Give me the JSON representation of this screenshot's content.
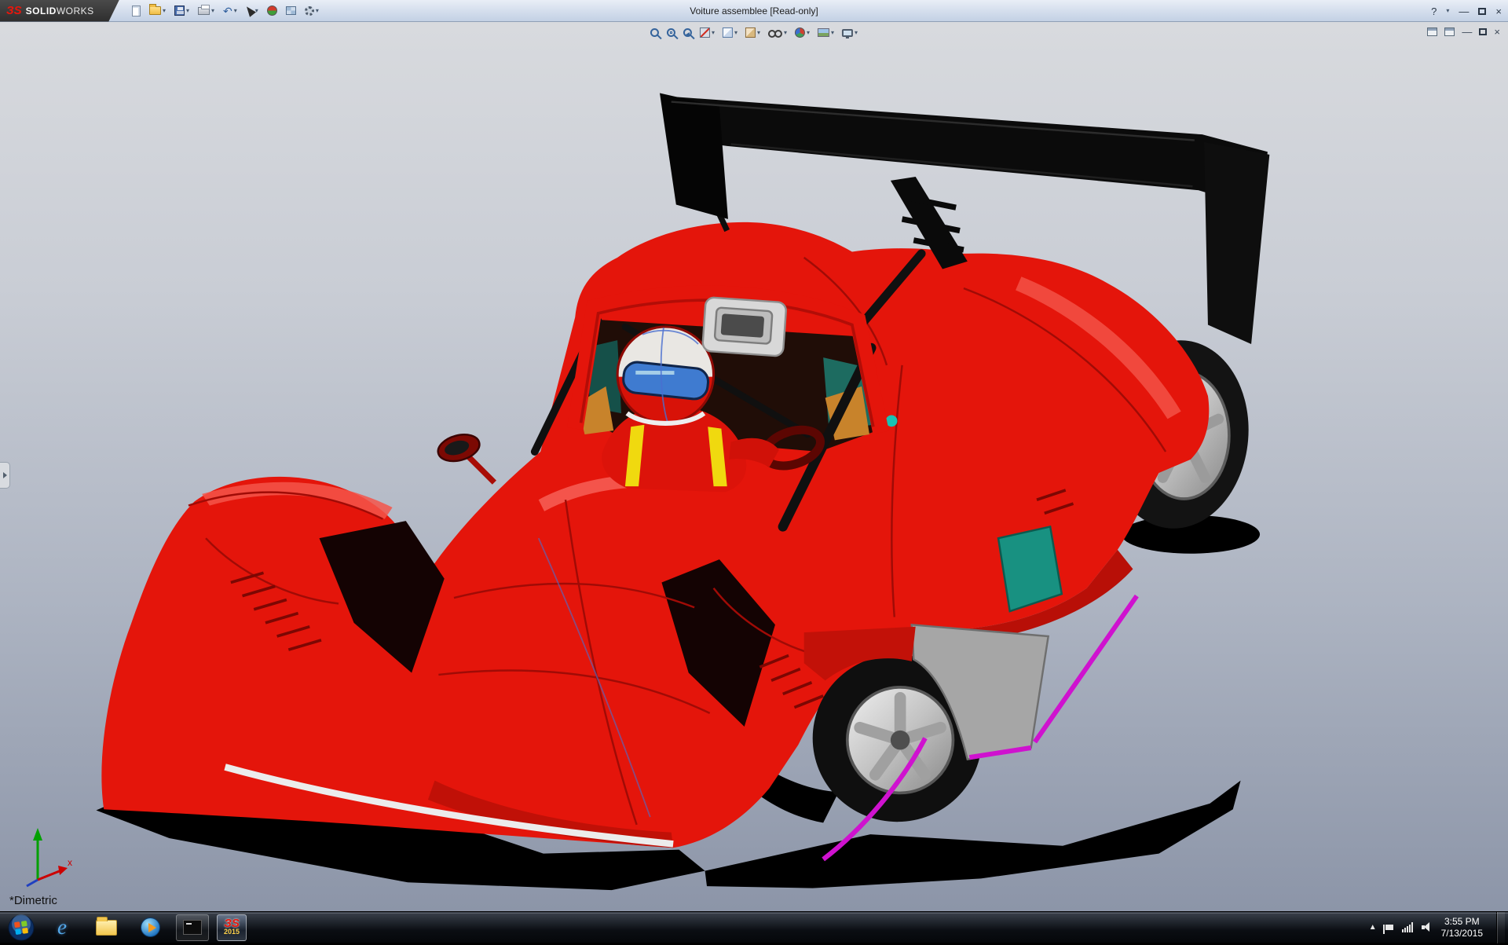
{
  "glyphs": {
    "caret": "▾",
    "undo": "↶",
    "ie": "e",
    "sw_mark": "ЗS",
    "tray_up": "▲"
  },
  "titlebar": {
    "brand": {
      "mark": "ЗS",
      "bold": "SOLID",
      "light": "WORKS"
    },
    "title": "Voiture assemblee [Read-only]",
    "tools": [
      {
        "name": "new"
      },
      {
        "name": "open",
        "dropdown": true
      },
      {
        "name": "save",
        "dropdown": true
      },
      {
        "name": "print",
        "dropdown": true
      },
      {
        "name": "undo",
        "dropdown": true
      },
      {
        "name": "select",
        "dropdown": true
      },
      {
        "name": "rebuild"
      },
      {
        "name": "display-grid"
      },
      {
        "name": "options",
        "dropdown": true
      }
    ],
    "controls": {
      "help": "?",
      "minimize": "—",
      "close": "×"
    }
  },
  "doc_window": {
    "minimize": "—",
    "close": "×"
  },
  "view_toolbar": {
    "items": [
      {
        "name": "zoom-to-fit"
      },
      {
        "name": "zoom-to-area"
      },
      {
        "name": "previous-view"
      },
      {
        "name": "section-view",
        "dropdown": true
      },
      {
        "name": "view-orientation",
        "dropdown": true
      },
      {
        "name": "display-style",
        "dropdown": true
      },
      {
        "name": "hide-show-items",
        "dropdown": true
      },
      {
        "name": "edit-appearance",
        "dropdown": true
      },
      {
        "name": "apply-scene",
        "dropdown": true
      },
      {
        "name": "view-settings",
        "dropdown": true
      }
    ]
  },
  "viewport": {
    "orientation_label": "*Dimetric",
    "triad_x_label": "x",
    "model": "red prototype race car assembly with rear wing and driver"
  },
  "taskbar": {
    "solidworks_badge": "2015",
    "clock": {
      "time": "3:55 PM",
      "date": "7/13/2015"
    }
  }
}
